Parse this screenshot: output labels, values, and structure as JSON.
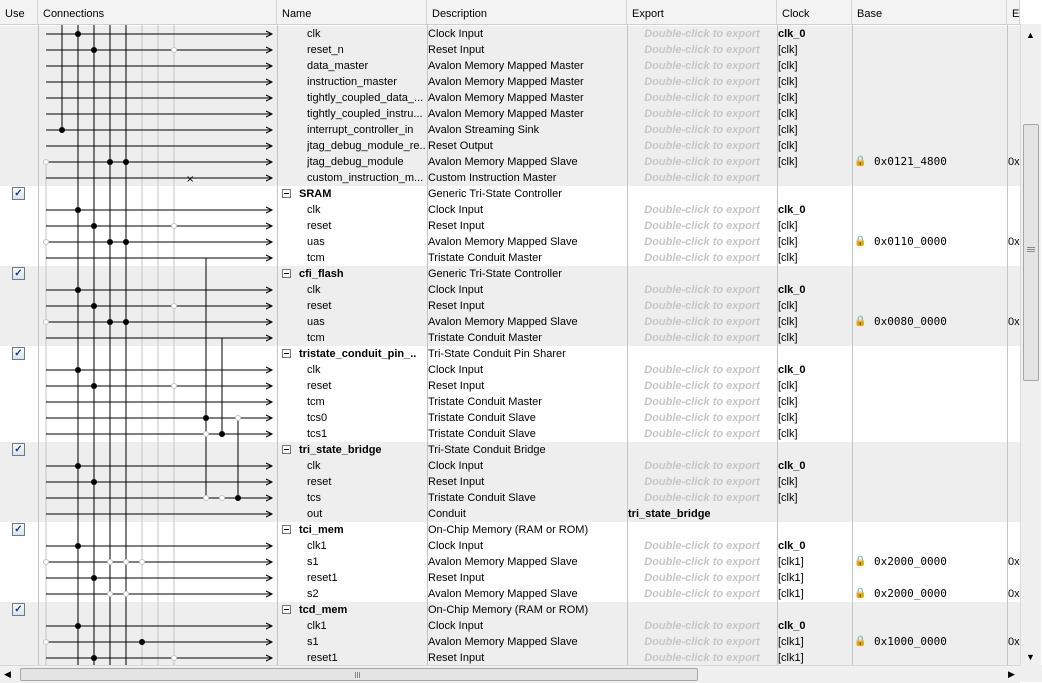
{
  "columns": {
    "use": "Use",
    "connections": "Connections",
    "name": "Name",
    "description": "Description",
    "export": "Export",
    "clock": "Clock",
    "base": "Base",
    "end": "E‑"
  },
  "colors": {
    "band_gray": "#eeeeee",
    "band_white": "#ffffff",
    "hint_text": "#c6c6c6",
    "line": "#000000",
    "faint_line": "#c4c4c4"
  },
  "rows": [
    {
      "name": "clk",
      "desc": "Clock Input",
      "export": "Double-click to export",
      "clock": "clk_0"
    },
    {
      "name": "reset_n",
      "desc": "Reset Input",
      "export": "Double-click to export",
      "clock": "[clk]"
    },
    {
      "name": "data_master",
      "desc": "Avalon Memory Mapped Master",
      "export": "Double-click to export",
      "clock": "[clk]"
    },
    {
      "name": "instruction_master",
      "desc": "Avalon Memory Mapped Master",
      "export": "Double-click to export",
      "clock": "[clk]"
    },
    {
      "name": "tightly_coupled_data_...",
      "desc": "Avalon Memory Mapped Master",
      "export": "Double-click to export",
      "clock": "[clk]"
    },
    {
      "name": "tightly_coupled_instru...",
      "desc": "Avalon Memory Mapped Master",
      "export": "Double-click to export",
      "clock": "[clk]"
    },
    {
      "name": "interrupt_controller_in",
      "desc": "Avalon Streaming Sink",
      "export": "Double-click to export",
      "clock": "[clk]"
    },
    {
      "name": "jtag_debug_module_re...",
      "desc": "Reset Output",
      "export": "Double-click to export",
      "clock": "[clk]"
    },
    {
      "name": "jtag_debug_module",
      "desc": "Avalon Memory Mapped Slave",
      "export": "Double-click to export",
      "clock": "[clk]",
      "base": "0x0121_4800",
      "lock": "dim",
      "end": "0x"
    },
    {
      "name": "custom_instruction_m...",
      "desc": "Custom Instruction Master",
      "export": "Double-click to export"
    },
    {
      "name": "SRAM",
      "desc": "Generic Tri-State Controller",
      "comp": true,
      "checked": true
    },
    {
      "name": "clk",
      "desc": "Clock Input",
      "export": "Double-click to export",
      "clock": "clk_0"
    },
    {
      "name": "reset",
      "desc": "Reset Input",
      "export": "Double-click to export",
      "clock": "[clk]"
    },
    {
      "name": "uas",
      "desc": "Avalon Memory Mapped Slave",
      "export": "Double-click to export",
      "clock": "[clk]",
      "base": "0x0110_0000",
      "lock": "dim",
      "end": "0x"
    },
    {
      "name": "tcm",
      "desc": "Tristate Conduit Master",
      "export": "Double-click to export",
      "clock": "[clk]"
    },
    {
      "name": "cfi_flash",
      "desc": "Generic Tri-State Controller",
      "comp": true,
      "checked": true
    },
    {
      "name": "clk",
      "desc": "Clock Input",
      "export": "Double-click to export",
      "clock": "clk_0"
    },
    {
      "name": "reset",
      "desc": "Reset Input",
      "export": "Double-click to export",
      "clock": "[clk]"
    },
    {
      "name": "uas",
      "desc": "Avalon Memory Mapped Slave",
      "export": "Double-click to export",
      "clock": "[clk]",
      "base": "0x0080_0000",
      "lock": "dim",
      "end": "0x"
    },
    {
      "name": "tcm",
      "desc": "Tristate Conduit Master",
      "export": "Double-click to export",
      "clock": "[clk]"
    },
    {
      "name": "tristate_conduit_pin_...",
      "desc": "Tri-State Conduit Pin Sharer",
      "comp": true,
      "checked": true
    },
    {
      "name": "clk",
      "desc": "Clock Input",
      "export": "Double-click to export",
      "clock": "clk_0"
    },
    {
      "name": "reset",
      "desc": "Reset Input",
      "export": "Double-click to export",
      "clock": "[clk]"
    },
    {
      "name": "tcm",
      "desc": "Tristate Conduit Master",
      "export": "Double-click to export",
      "clock": "[clk]"
    },
    {
      "name": "tcs0",
      "desc": "Tristate Conduit Slave",
      "export": "Double-click to export",
      "clock": "[clk]"
    },
    {
      "name": "tcs1",
      "desc": "Tristate Conduit Slave",
      "export": "Double-click to export",
      "clock": "[clk]"
    },
    {
      "name": "tri_state_bridge",
      "desc": "Tri-State Conduit Bridge",
      "comp": true,
      "checked": true
    },
    {
      "name": "clk",
      "desc": "Clock Input",
      "export": "Double-click to export",
      "clock": "clk_0"
    },
    {
      "name": "reset",
      "desc": "Reset Input",
      "export": "Double-click to export",
      "clock": "[clk]"
    },
    {
      "name": "tcs",
      "desc": "Tristate Conduit Slave",
      "export": "Double-click to export",
      "clock": "[clk]"
    },
    {
      "name": "out",
      "desc": "Conduit",
      "exportval": "tri_state_bridge"
    },
    {
      "name": "tci_mem",
      "desc": "On-Chip Memory (RAM or ROM)",
      "comp": true,
      "checked": true
    },
    {
      "name": "clk1",
      "desc": "Clock Input",
      "export": "Double-click to export",
      "clock": "clk_0"
    },
    {
      "name": "s1",
      "desc": "Avalon Memory Mapped Slave",
      "export": "Double-click to export",
      "clock": "[clk1]",
      "base": "0x2000_0000",
      "lock": "on",
      "end": "0x"
    },
    {
      "name": "reset1",
      "desc": "Reset Input",
      "export": "Double-click to export",
      "clock": "[clk1]"
    },
    {
      "name": "s2",
      "desc": "Avalon Memory Mapped Slave",
      "export": "Double-click to export",
      "clock": "[clk1]",
      "base": "0x2000_0000",
      "lock": "on",
      "end": "0x"
    },
    {
      "name": "tcd_mem",
      "desc": "On-Chip Memory (RAM or ROM)",
      "comp": true,
      "checked": true
    },
    {
      "name": "clk1",
      "desc": "Clock Input",
      "export": "Double-click to export",
      "clock": "clk_0"
    },
    {
      "name": "s1",
      "desc": "Avalon Memory Mapped Slave",
      "export": "Double-click to export",
      "clock": "[clk1]",
      "base": "0x1000_0000",
      "lock": "on",
      "end": "0x"
    },
    {
      "name": "reset1",
      "desc": "Reset Input",
      "export": "Double-click to export",
      "clock": "[clk1]"
    }
  ]
}
